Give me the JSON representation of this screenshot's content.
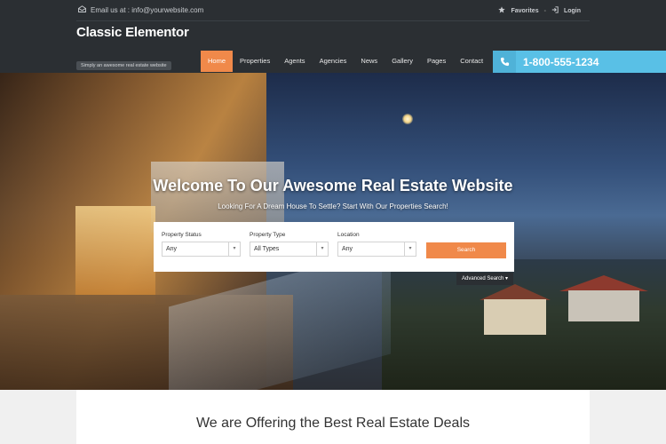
{
  "topbar": {
    "email_text": "Email us at : info@yourwebsite.com",
    "favorites_label": "Favorites",
    "separator": "-",
    "login_label": "Login"
  },
  "header": {
    "logo": "Classic Elementor",
    "tagline": "Simply an awesome real estate website",
    "nav": [
      {
        "label": "Home"
      },
      {
        "label": "Properties"
      },
      {
        "label": "Agents"
      },
      {
        "label": "Agencies"
      },
      {
        "label": "News"
      },
      {
        "label": "Gallery"
      },
      {
        "label": "Pages"
      },
      {
        "label": "Contact"
      }
    ],
    "phone": "1-800-555-1234"
  },
  "hero": {
    "title": "Welcome To Our Awesome Real Estate Website",
    "subtitle": "Looking For A Dream House To Settle? Start With Our Properties Search!"
  },
  "search": {
    "status_label": "Property Status",
    "status_value": "Any",
    "type_label": "Property Type",
    "type_value": "All Types",
    "location_label": "Location",
    "location_value": "Any",
    "search_button": "Search",
    "advanced_label": "Advanced Search"
  },
  "section": {
    "title": "We are Offering the Best Real Estate Deals"
  },
  "colors": {
    "accent": "#f0894a",
    "phone_bg": "#59c0e6",
    "dark_bg": "#2b2f33"
  }
}
